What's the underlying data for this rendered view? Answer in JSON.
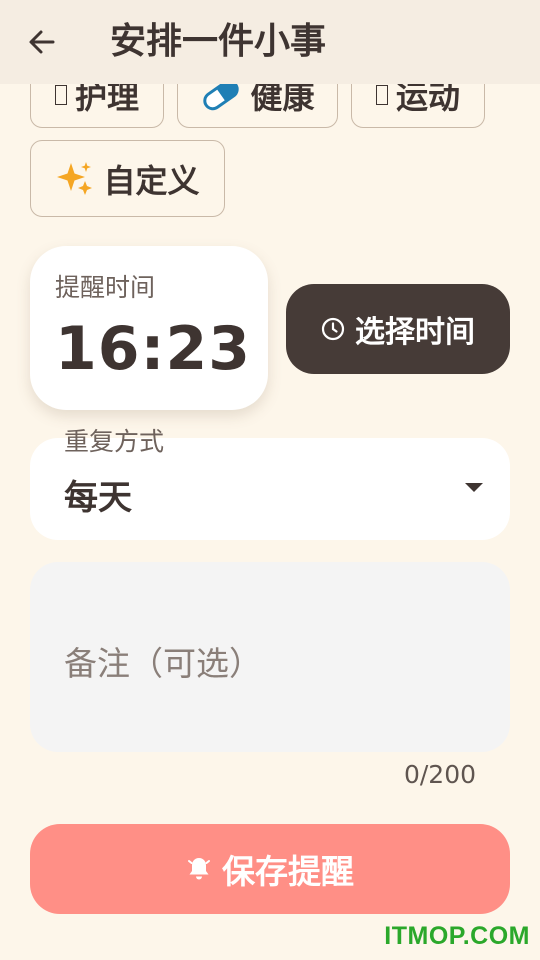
{
  "header": {
    "title": "安排一件小事",
    "back_icon": "arrow-left-icon"
  },
  "categories": [
    {
      "label": "护理",
      "icon": "missing-glyph-icon"
    },
    {
      "label": "健康",
      "icon": "pill-icon",
      "icon_color": "#1F7FB5"
    },
    {
      "label": "运动",
      "icon": "missing-glyph-icon"
    },
    {
      "label": "自定义",
      "icon": "sparkles-icon",
      "icon_color": "#F5A623"
    }
  ],
  "reminder_time": {
    "label": "提醒时间",
    "value": "16:23",
    "select_button_label": "选择时间",
    "select_button_icon": "clock-icon"
  },
  "repeat": {
    "label": "重复方式",
    "value": "每天"
  },
  "note": {
    "placeholder": "备注（可选）",
    "counter": "0/200"
  },
  "save_button": {
    "label": "保存提醒",
    "icon": "bell-icon"
  },
  "watermark": "ITMOP.COM",
  "colors": {
    "background": "#FDF6EA",
    "header": "#F5EDE2",
    "primary_dark": "#463B37",
    "save_button": "#FF8F86",
    "watermark": "#2BA82B"
  }
}
